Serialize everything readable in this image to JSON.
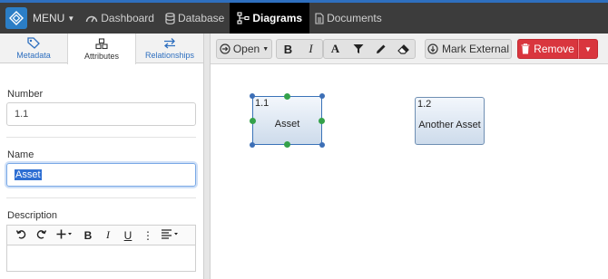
{
  "navbar": {
    "menu_label": "MENU",
    "items": [
      {
        "label": "Dashboard",
        "icon": "dashboard-icon"
      },
      {
        "label": "Database",
        "icon": "database-icon"
      },
      {
        "label": "Diagrams",
        "icon": "diagram-icon",
        "active": true
      },
      {
        "label": "Documents",
        "icon": "document-icon"
      }
    ]
  },
  "left_panel": {
    "tabs": [
      {
        "label": "Metadata",
        "icon": "tag-icon"
      },
      {
        "label": "Attributes",
        "icon": "cubes-icon",
        "active": true
      },
      {
        "label": "Relationships",
        "icon": "exchange-icon"
      }
    ],
    "number": {
      "label": "Number",
      "value": "1.1"
    },
    "name": {
      "label": "Name",
      "value": "Asset"
    },
    "description": {
      "label": "Description"
    }
  },
  "toolbar": {
    "open_label": "Open",
    "mark_external_label": "Mark External",
    "remove_label": "Remove"
  },
  "canvas": {
    "nodes": [
      {
        "id": "1.1",
        "label": "Asset",
        "selected": true
      },
      {
        "id": "1.2",
        "label": "Another Asset",
        "selected": false
      }
    ]
  },
  "colors": {
    "navbar_bg": "#3c3c3c",
    "accent": "#2e6fbf",
    "remove": "#d9363e",
    "handle_green": "#34a14a"
  }
}
